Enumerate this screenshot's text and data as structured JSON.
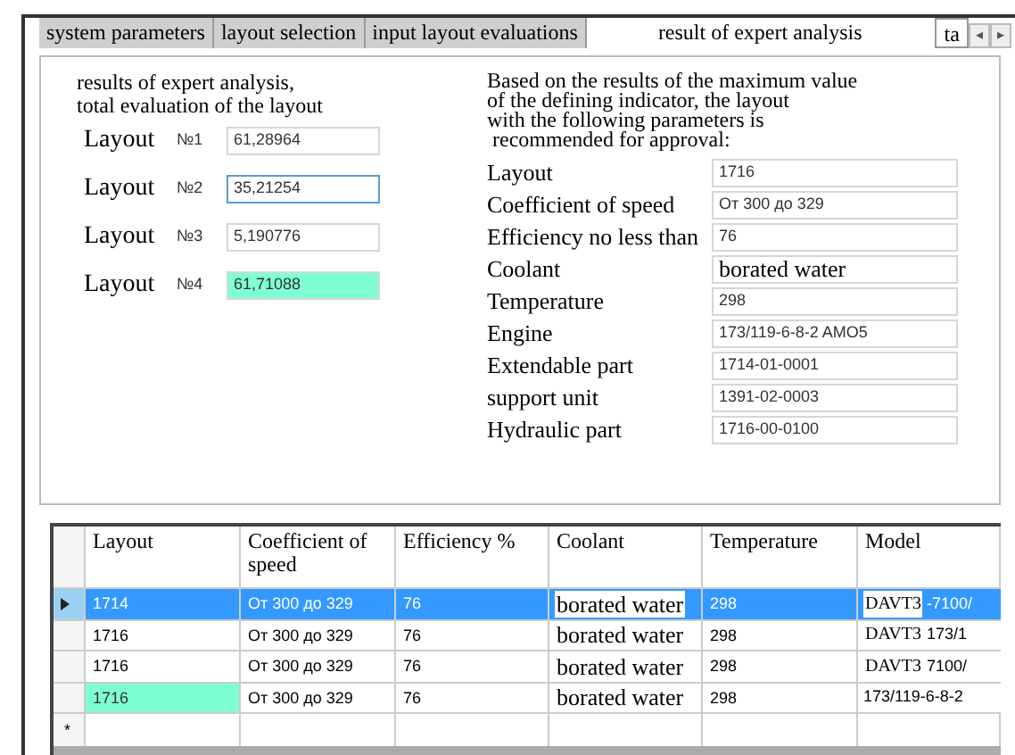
{
  "tabs": [
    {
      "label": "system parameters",
      "selected": false
    },
    {
      "label": "layout selection",
      "selected": false
    },
    {
      "label": "input layout evaluations",
      "selected": false
    },
    {
      "label": "result of expert analysis",
      "selected": true
    },
    {
      "label": "ta",
      "selected": false
    }
  ],
  "tab_scroll": [
    "◂",
    "▸"
  ],
  "evaluation": {
    "heading": [
      "results of expert analysis,",
      "total evaluation of  the layout"
    ],
    "items": [
      {
        "label": "Layout",
        "number": "№1",
        "value": "61,28964",
        "highlighted": false,
        "focused": false
      },
      {
        "label": "Layout",
        "number": "№2",
        "value": "35,21254",
        "highlighted": false,
        "focused": true
      },
      {
        "label": "Layout",
        "number": "№3",
        "value": "5,190776",
        "highlighted": false,
        "focused": false
      },
      {
        "label": "Layout",
        "number": "№4",
        "value": "61,71088",
        "highlighted": true,
        "focused": false
      }
    ]
  },
  "recommendation": {
    "description": [
      "Based on the results of the maximum value",
      "of the defining indicator, the layout",
      "with the following parameters is",
      " recommended for approval:"
    ],
    "parameters": [
      {
        "label": "Layout",
        "value": "1716",
        "kind": "plain"
      },
      {
        "label": "Coefficient of speed",
        "value": "От 300 до 329",
        "kind": "plain"
      },
      {
        "label": "Efficiency no less than",
        "value": "76",
        "kind": "plain"
      },
      {
        "label": "Coolant",
        "value": "borated water",
        "kind": "large"
      },
      {
        "label": "Temperature",
        "value": "298",
        "kind": "plain"
      },
      {
        "label": "Engine",
        "value": "173/119-6-8-2 AMO5",
        "kind": "plain"
      },
      {
        "label": "Extendable part",
        "value": "1714-01-0001",
        "kind": "plain"
      },
      {
        "label": "support unit",
        "value": "1391-02-0003",
        "kind": "plain"
      },
      {
        "label": "Hydraulic part",
        "value": "1716-00-0100",
        "kind": "plain"
      }
    ]
  },
  "table": {
    "columns": [
      "Layout",
      "Coefficient of speed",
      "Efficiency %",
      "Coolant",
      "Temperature",
      "Model"
    ],
    "rows": [
      {
        "selected": true,
        "highlighted": false,
        "layout": "1714",
        "speed": "От 300 до 329",
        "efficiency": "76",
        "coolant": "borated water",
        "temperature": "298",
        "model_prefix": "DAVT3",
        "model": "-7100/"
      },
      {
        "selected": false,
        "highlighted": false,
        "layout": "1716",
        "speed": "От 300 до 329",
        "efficiency": "76",
        "coolant": "borated water",
        "temperature": "298",
        "model_prefix": "DAVT3",
        "model": "173/1"
      },
      {
        "selected": false,
        "highlighted": false,
        "layout": "1716",
        "speed": "От 300 до 329",
        "efficiency": "76",
        "coolant": "borated water",
        "temperature": "298",
        "model_prefix": "DAVT3",
        "model": "7100/"
      },
      {
        "selected": false,
        "highlighted": true,
        "layout": "1716",
        "speed": "От 300 до 329",
        "efficiency": "76",
        "coolant": "borated water",
        "temperature": "298",
        "model": "173/119-6-8-2"
      }
    ],
    "new_row_marker": "*"
  }
}
